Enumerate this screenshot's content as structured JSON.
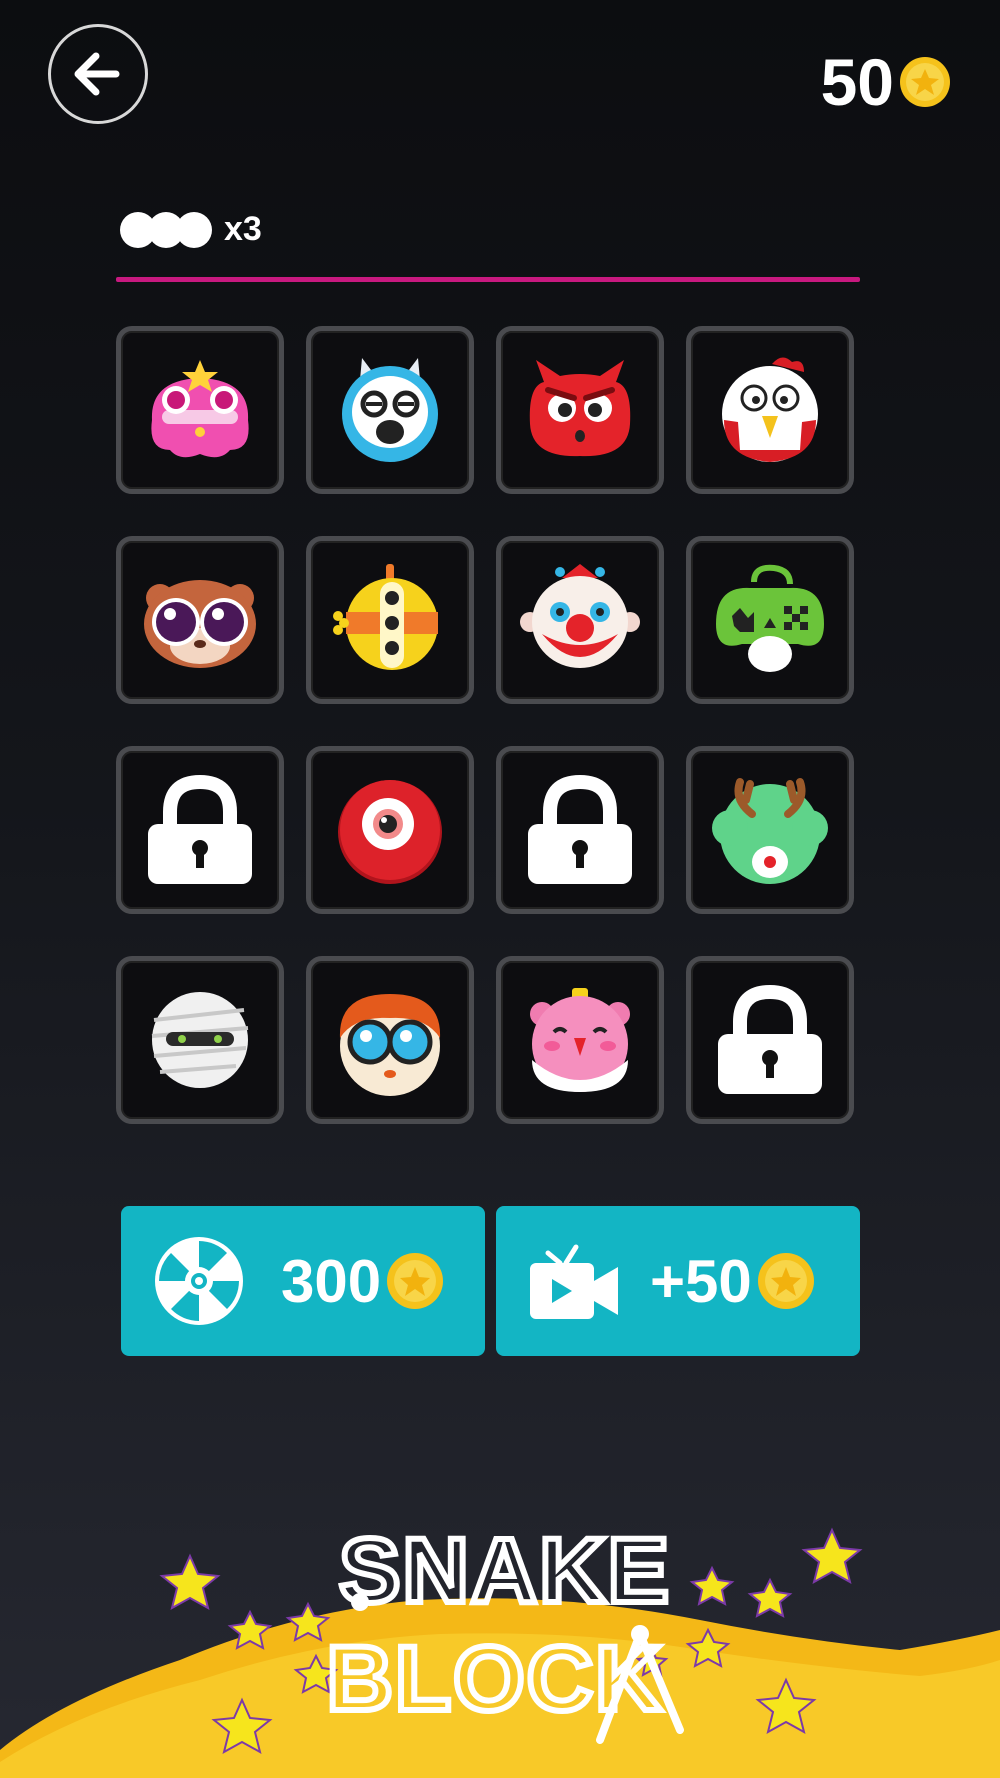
{
  "header": {
    "back_icon": "arrow-left-icon",
    "coins": "50",
    "coin_icon": "gold-coin-icon"
  },
  "snake": {
    "length_label": "x3"
  },
  "colors": {
    "background": "#0c0d10",
    "divider": "#c8197f",
    "button": "#13b5c4",
    "coin": "#f5c21b",
    "banner": "#f4b817"
  },
  "skins": [
    {
      "name": "princess-skin",
      "locked": false
    },
    {
      "name": "llama-skin",
      "locked": false
    },
    {
      "name": "red-cat-skin",
      "locked": false
    },
    {
      "name": "chicken-skin",
      "locked": false
    },
    {
      "name": "hamster-skin",
      "locked": false
    },
    {
      "name": "yellow-robot-skin",
      "locked": false
    },
    {
      "name": "clown-skin",
      "locked": false
    },
    {
      "name": "game-controller-skin",
      "locked": false
    },
    {
      "name": "locked-skin",
      "locked": true
    },
    {
      "name": "red-eyeball-skin",
      "locked": false
    },
    {
      "name": "locked-skin",
      "locked": true
    },
    {
      "name": "green-reindeer-skin",
      "locked": false
    },
    {
      "name": "mummy-skin",
      "locked": false
    },
    {
      "name": "scientist-kid-skin",
      "locked": false
    },
    {
      "name": "pink-pig-skin",
      "locked": false
    },
    {
      "name": "locked-skin",
      "locked": true
    }
  ],
  "buttons": {
    "spin": {
      "icon": "prize-wheel-icon",
      "label": "300"
    },
    "video": {
      "icon": "video-ad-icon",
      "label": "+50"
    }
  },
  "logo": {
    "line1": "SNAKE",
    "line2": "BLOCK"
  }
}
